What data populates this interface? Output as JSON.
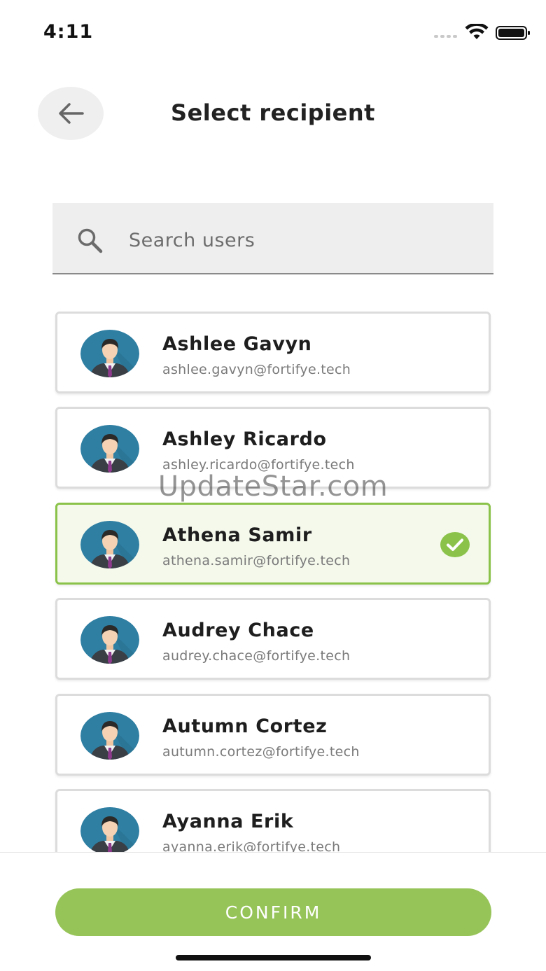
{
  "status_bar": {
    "time": "4:11",
    "wifi_icon": "wifi-icon",
    "battery_icon": "battery-icon"
  },
  "header": {
    "back_icon": "arrow-left-icon",
    "title": "Select recipient"
  },
  "search": {
    "placeholder": "Search users",
    "value": "",
    "icon": "search-icon"
  },
  "users": [
    {
      "name": "Ashlee Gavyn",
      "email": "ashlee.gavyn@fortifye.tech",
      "selected": false
    },
    {
      "name": "Ashley Ricardo",
      "email": "ashley.ricardo@fortifye.tech",
      "selected": false
    },
    {
      "name": "Athena Samir",
      "email": "athena.samir@fortifye.tech",
      "selected": true
    },
    {
      "name": "Audrey Chace",
      "email": "audrey.chace@fortifye.tech",
      "selected": false
    },
    {
      "name": "Autumn Cortez",
      "email": "autumn.cortez@fortifye.tech",
      "selected": false
    },
    {
      "name": "Ayanna Erik",
      "email": "ayanna.erik@fortifye.tech",
      "selected": false
    }
  ],
  "confirm_label": "CONFIRM",
  "watermark": "UpdateStar.com",
  "colors": {
    "accent": "#97c459",
    "selected_border": "#8bc34a",
    "selected_bg": "#f4f9ec"
  }
}
